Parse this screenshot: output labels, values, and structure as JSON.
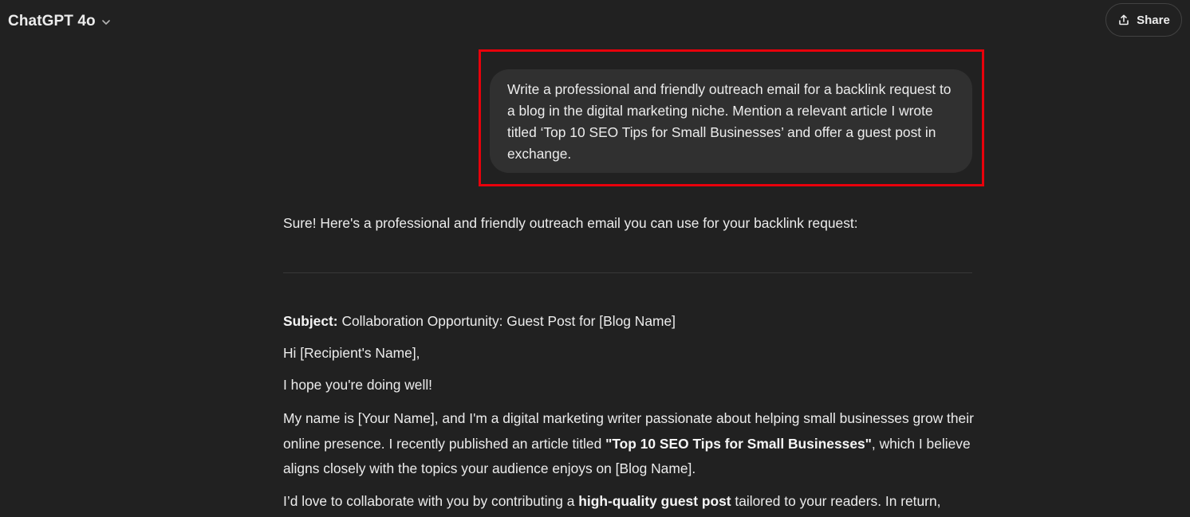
{
  "header": {
    "model_name": "ChatGPT 4o",
    "share_label": "Share"
  },
  "user_message": {
    "text": "Write a professional and friendly outreach email for a backlink request to a blog in the digital marketing niche. Mention a relevant article I wrote titled ‘Top 10 SEO Tips for Small Businesses’ and offer a guest post in exchange."
  },
  "assistant": {
    "intro": "Sure! Here's a professional and friendly outreach email you can use for your backlink request:",
    "subject_label": "Subject:",
    "subject_text": " Collaboration Opportunity: Guest Post for [Blog Name]",
    "greeting": "Hi [Recipient's Name],",
    "line_hope": "I hope you're doing well!",
    "para1_a": "My name is [Your Name], and I'm a digital marketing writer passionate about helping small businesses grow their online presence. I recently published an article titled ",
    "para1_bold": "\"Top 10 SEO Tips for Small Businesses\"",
    "para1_b": ", which I believe aligns closely with the topics your audience enjoys on [Blog Name].",
    "para2_a": "I’d love to collaborate with you by contributing a ",
    "para2_bold": "high-quality guest post",
    "para2_b": " tailored to your readers. In return,"
  },
  "colors": {
    "background": "#212121",
    "bubble": "#303030",
    "highlight": "#e8000b",
    "text": "#ececec"
  },
  "icons": {
    "model_chevron": "chevron-down-icon",
    "share": "share-upload-icon"
  }
}
